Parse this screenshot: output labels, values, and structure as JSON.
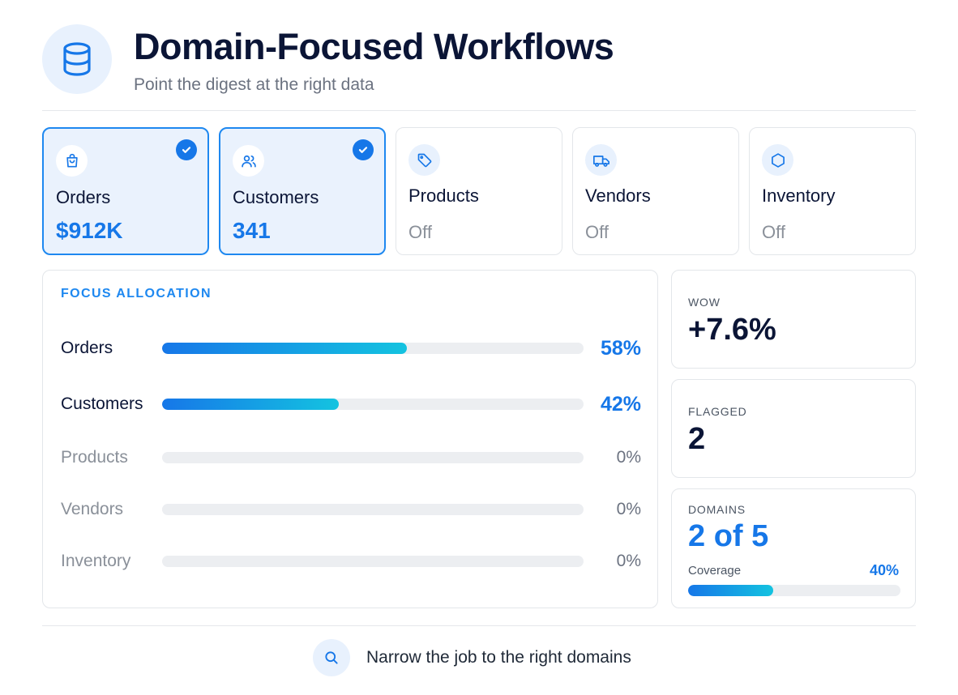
{
  "header": {
    "title": "Domain-Focused Workflows",
    "subtitle": "Point the digest at the right data",
    "icon": "database-icon"
  },
  "domains": [
    {
      "label": "Orders",
      "value": "$912K",
      "selected": true,
      "icon": "shopping-bag-icon"
    },
    {
      "label": "Customers",
      "value": "341",
      "selected": true,
      "icon": "users-icon"
    },
    {
      "label": "Products",
      "value": "Off",
      "selected": false,
      "icon": "tag-icon"
    },
    {
      "label": "Vendors",
      "value": "Off",
      "selected": false,
      "icon": "truck-icon"
    },
    {
      "label": "Inventory",
      "value": "Off",
      "selected": false,
      "icon": "hexagon-icon"
    }
  ],
  "allocation": {
    "heading": "FOCUS ALLOCATION",
    "rows": [
      {
        "label": "Orders",
        "pct_label": "58%",
        "fraction": 0.58
      },
      {
        "label": "Customers",
        "pct_label": "42%",
        "fraction": 0.42
      },
      {
        "label": "Products",
        "pct_label": "0%",
        "fraction": 0
      },
      {
        "label": "Vendors",
        "pct_label": "0%",
        "fraction": 0
      },
      {
        "label": "Inventory",
        "pct_label": "0%",
        "fraction": 0
      }
    ]
  },
  "stats": {
    "wow": {
      "label": "WOW",
      "value": "+7.6%"
    },
    "flagged": {
      "label": "FLAGGED",
      "value": "2"
    },
    "domains": {
      "label": "DOMAINS",
      "value": "2 of 5",
      "coverage_label": "Coverage",
      "coverage_pct_label": "40%",
      "coverage_fraction": 0.4
    }
  },
  "footer": {
    "text": "Narrow the job to the right domains",
    "icon": "search-icon"
  },
  "colors": {
    "accent": "#1677e8",
    "gradient_end": "#14c3e0",
    "selected_bg": "#eaf2fd",
    "muted_text": "#8a9099"
  }
}
